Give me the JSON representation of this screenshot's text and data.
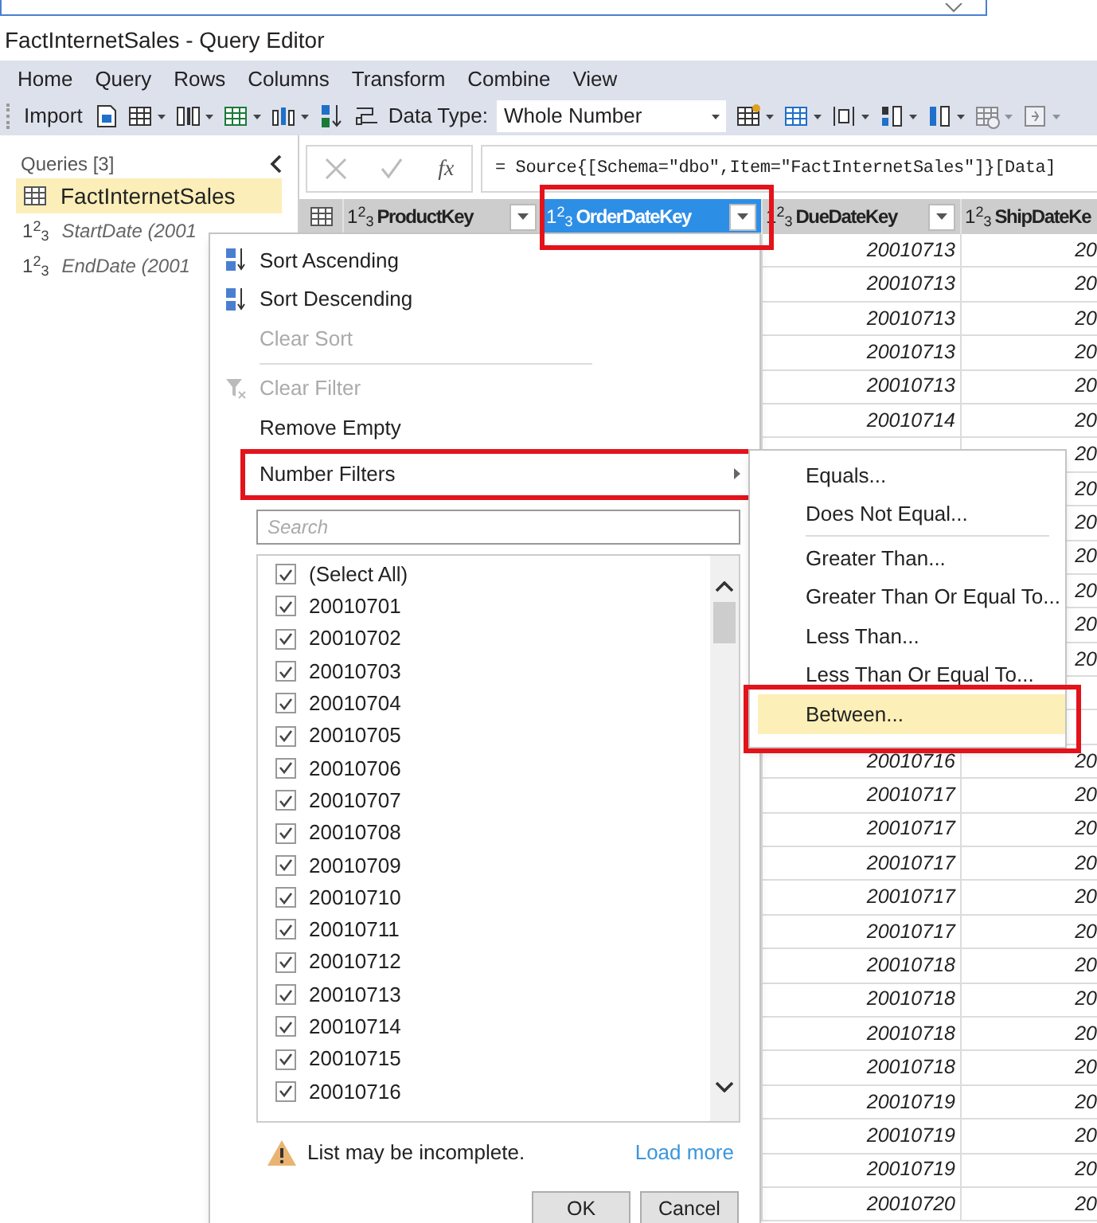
{
  "window": {
    "title": "FactInternetSales - Query Editor"
  },
  "menu_tabs": [
    "Home",
    "Query",
    "Rows",
    "Columns",
    "Transform",
    "Combine",
    "View"
  ],
  "toolbar": {
    "import": "Import",
    "data_type_label": "Data Type:",
    "data_type_value": "Whole Number"
  },
  "queries": {
    "title": "Queries [3]",
    "items": [
      {
        "kind": "table",
        "name": "FactInternetSales",
        "selected": true
      },
      {
        "kind": "number",
        "type_label": "1$^{2}$$_{3}$",
        "name": "StartDate (2001",
        "selected": false
      },
      {
        "kind": "number",
        "type_label": "1$^{2}$$_{3}$",
        "name": "EndDate (2001",
        "selected": false
      }
    ]
  },
  "formula": {
    "fx": "fx",
    "text": "= Source{[Schema=\"dbo\",Item=\"FactInternetSales\"]}[Data]"
  },
  "table": {
    "columns": [
      {
        "type_label": "1$^{2}$$_{3}$",
        "name": "ProductKey",
        "selected": false,
        "highlighted": false
      },
      {
        "type_label": "1$^{2}$$_{3}$",
        "name": "OrderDateKey",
        "selected": true,
        "highlighted": true
      },
      {
        "type_label": "1$^{2}$$_{3}$",
        "name": "DueDateKey",
        "selected": false,
        "highlighted": false
      },
      {
        "type_label": "1$^{2}$$_{3}$",
        "name": "ShipDateKe",
        "selected": false,
        "highlighted": false
      }
    ],
    "rows": [
      {
        "due": "20010713",
        "ship": "20"
      },
      {
        "due": "20010713",
        "ship": "20"
      },
      {
        "due": "20010713",
        "ship": "20"
      },
      {
        "due": "20010713",
        "ship": "20"
      },
      {
        "due": "20010713",
        "ship": "20"
      },
      {
        "due": "20010714",
        "ship": "20"
      },
      {
        "ship": "20"
      },
      {
        "ship": "20"
      },
      {
        "ship": "20"
      },
      {
        "ship": "20"
      },
      {
        "ship": "20"
      },
      {
        "ship": "20"
      },
      {
        "ship": "20"
      },
      {},
      {},
      {
        "due": "20010716",
        "ship": "20"
      },
      {
        "due": "20010717",
        "ship": "20"
      },
      {
        "due": "20010717",
        "ship": "20"
      },
      {
        "due": "20010717",
        "ship": "20"
      },
      {
        "due": "20010717",
        "ship": "20"
      },
      {
        "due": "20010717",
        "ship": "20"
      },
      {
        "due": "20010718",
        "ship": "20"
      },
      {
        "due": "20010718",
        "ship": "20"
      },
      {
        "due": "20010718",
        "ship": "20"
      },
      {
        "due": "20010718",
        "ship": "20"
      },
      {
        "due": "20010719",
        "ship": "20"
      },
      {
        "due": "20010719",
        "ship": "20"
      },
      {
        "due": "20010719",
        "ship": "20"
      },
      {
        "due": "20010720",
        "ship": "20"
      }
    ]
  },
  "filter_menu": {
    "items": [
      {
        "kind": "sort_asc",
        "label": "Sort Ascending",
        "disabled": false,
        "highlighted": false
      },
      {
        "kind": "sort_desc",
        "label": "Sort Descending",
        "disabled": false,
        "highlighted": false
      },
      {
        "kind": "plain",
        "label": "Clear Sort",
        "disabled": true,
        "highlighted": false
      },
      {
        "kind": "divider"
      },
      {
        "kind": "clear_filter",
        "label": "Clear Filter",
        "disabled": true,
        "highlighted": false
      },
      {
        "kind": "plain",
        "label": "Remove Empty",
        "disabled": false,
        "highlighted": false
      },
      {
        "kind": "submenu",
        "label": "Number Filters",
        "disabled": false,
        "highlighted": true
      }
    ],
    "search": {
      "placeholder": "Search"
    },
    "values": [
      {
        "label": "(Select All)",
        "checked": true
      },
      {
        "label": "20010701",
        "checked": true
      },
      {
        "label": "20010702",
        "checked": true
      },
      {
        "label": "20010703",
        "checked": true
      },
      {
        "label": "20010704",
        "checked": true
      },
      {
        "label": "20010705",
        "checked": true
      },
      {
        "label": "20010706",
        "checked": true
      },
      {
        "label": "20010707",
        "checked": true
      },
      {
        "label": "20010708",
        "checked": true
      },
      {
        "label": "20010709",
        "checked": true
      },
      {
        "label": "20010710",
        "checked": true
      },
      {
        "label": "20010711",
        "checked": true
      },
      {
        "label": "20010712",
        "checked": true
      },
      {
        "label": "20010713",
        "checked": true
      },
      {
        "label": "20010714",
        "checked": true
      },
      {
        "label": "20010715",
        "checked": true
      },
      {
        "label": "20010716",
        "checked": true
      }
    ],
    "warning": "List may be incomplete.",
    "load_more": "Load more",
    "buttons": [
      "OK",
      "Cancel"
    ]
  },
  "submenu": {
    "items": [
      {
        "kind": "item",
        "label": "Equals...",
        "selected": false,
        "highlighted": false
      },
      {
        "kind": "item",
        "label": "Does Not Equal...",
        "selected": false,
        "highlighted": false
      },
      {
        "kind": "divider"
      },
      {
        "kind": "item",
        "label": "Greater Than...",
        "selected": false,
        "highlighted": false
      },
      {
        "kind": "item",
        "label": "Greater Than Or Equal To...",
        "selected": false,
        "highlighted": false
      },
      {
        "kind": "item",
        "label": "Less Than...",
        "selected": false,
        "highlighted": false
      },
      {
        "kind": "item",
        "label": "Less Than Or Equal To...",
        "selected": false,
        "highlighted": false
      },
      {
        "kind": "item",
        "label": "Between...",
        "selected": true,
        "highlighted": true
      }
    ]
  }
}
